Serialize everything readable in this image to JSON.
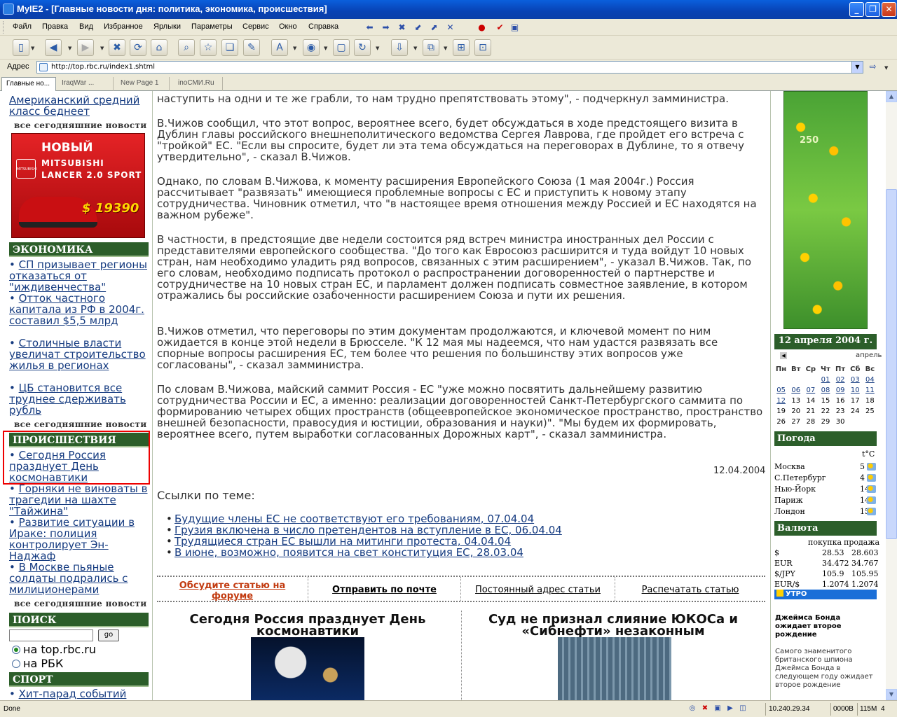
{
  "window": {
    "title": "MyIE2 - [Главные новости дня: политика, экономика, происшествия]",
    "buttons": [
      "_",
      "❐",
      "✕"
    ]
  },
  "menu": {
    "items": [
      "Файл",
      "Правка",
      "Вид",
      "Избранное",
      "Ярлыки",
      "Параметры",
      "Сервис",
      "Окно",
      "Справка"
    ]
  },
  "address": {
    "label": "Адрес",
    "url": "http://top.rbc.ru/index1.shtml"
  },
  "tabs": [
    "Главные но...",
    "IraqWar ...",
    "New Page 1",
    "inoСМИ.Ru"
  ],
  "left": {
    "top_news_tail": "Американский средний класс беднеет",
    "all_news": "все сегодняшние новости",
    "ad": {
      "line1": "НОВЫЙ",
      "line2": "MITSUBISHI",
      "line3": "LANCER 2.0 SPORT",
      "price": "$ 19390",
      "logo": "MITSUBISHI"
    },
    "economy": {
      "title": "ЭКОНОМИКА",
      "items": [
        "СП призывает регионы отказаться от \"иждивенчества\"",
        "Отток частного капитала из РФ в 2004г. составил $5,5 млрд",
        "Столичные власти увеличат строительство жилья в регионах",
        "ЦБ становится все труднее сдерживать рубль"
      ]
    },
    "incidents": {
      "title": "ПРОИСШЕСТВИЯ",
      "items": [
        "Сегодня Россия празднует День космонавтики",
        "Горняки не виноваты в трагедии на шахте \"Тайжина\"",
        "Развитие ситуации в Ираке: полиция контролирует Эн-Наджаф",
        "В Москве пьяные солдаты подрались с милиционерами"
      ]
    },
    "search": {
      "title": "ПОИСК",
      "go": "go",
      "options": [
        "на top.rbc.ru",
        "на РБК"
      ]
    },
    "sport": {
      "title": "СПОРТ",
      "items": [
        "Хит-парад событий"
      ]
    }
  },
  "article": {
    "paragraphs": [
      "наступить на одни и те же грабли, то нам трудно препятствовать этому\", - подчеркнул замминистра.",
      "В.Чижов сообщил, что этот вопрос, вероятнее всего, будет обсуждаться в ходе предстоящего визита в Дублин главы российского внешнеполитического ведомства Сергея Лаврова, где пройдет его встреча с \"тройкой\" ЕС. \"Если вы спросите, будет ли эта тема обсуждаться на переговорах в Дублине, то я отвечу утвердительно\", - сказал В.Чижов.",
      "Однако, по словам В.Чижова, к моменту расширения Европейского Союза (1 мая 2004г.) Россия рассчитывает \"развязать\" имеющиеся проблемные вопросы с ЕС и приступить к новому этапу сотрудничества. Чиновник отметил, что \"в настоящее время отношения между Россией и ЕС находятся на важном рубеже\".",
      "В частности, в предстоящие две недели состоится ряд встреч министра иностранных дел России с представителями европейского сообщества. \"До того как Евросоюз расширится и туда войдут 10 новых стран, нам необходимо уладить ряд вопросов, связанных с этим расширением\", - указал В.Чижов. Так, по его словам, необходимо подписать протокол о распространении договоренностей о партнерстве и сотрудничестве на 10 новых стран ЕС, и парламент должен подписать совместное заявление, в котором отражались бы российские озабоченности расширением Союза и пути их решения.",
      "В.Чижов отметил, что переговоры по этим документам продолжаются, и ключевой момент по ним ожидается в конце этой недели в Брюсселе. \"К 12 мая мы надеемся, что нам удастся развязать все спорные вопросы расширения ЕС, тем более что решения по большинству этих вопросов уже согласованы\", - сказал замминистра.",
      "По словам В.Чижова, майский саммит Россия - ЕС \"уже можно посвятить дальнейшему развитию сотрудничества России и ЕС, а именно: реализации договоренностей Санкт-Петербургского саммита по формированию четырех общих пространств (общеевропейское экономическое пространство, пространство внешней безопасности, правосудия и юстиции, образования и науки)\". \"Мы будем их формировать, вероятнее всего, путем выработки согласованных Дорожных карт\", - сказал замминистра."
    ],
    "date": "12.04.2004",
    "related_title": "Ссылки по теме:",
    "related": [
      "Будущие члены ЕС не соответствуют его требованиям, 07.04.04",
      "Грузия включена в число претендентов на вступление в ЕС, 06.04.04",
      "Трудящиеся стран ЕС вышли на митинги протеста, 04.04.04",
      "В июне, возможно, появится на свет конституция ЕС, 28.03.04"
    ],
    "actions": [
      "Обсудите статью на форуме",
      "Отправить по почте",
      "Постоянный адрес статьи",
      "Распечатать статью"
    ],
    "teasers": [
      "Сегодня Россия празднует День космонавтики",
      "Суд не признал слияние ЮКОСа и «Сибнефти» незаконным"
    ]
  },
  "right": {
    "banner_number": "250",
    "calendar": {
      "date": "12 апреля 2004 г.",
      "month": "апрель",
      "weekdays": [
        "Пн",
        "Вт",
        "Ср",
        "Чт",
        "Пт",
        "Сб",
        "Вс"
      ],
      "weeks": [
        [
          "",
          "",
          "",
          "01",
          "02",
          "03",
          "04"
        ],
        [
          "05",
          "06",
          "07",
          "08",
          "09",
          "10",
          "11"
        ],
        [
          "12",
          "13",
          "14",
          "15",
          "16",
          "17",
          "18"
        ],
        [
          "19",
          "20",
          "21",
          "22",
          "23",
          "24",
          "25"
        ],
        [
          "26",
          "27",
          "28",
          "29",
          "30",
          "",
          ""
        ]
      ]
    },
    "weather": {
      "title": "Погода",
      "unit": "t°C",
      "rows": [
        {
          "city": "Москва",
          "temp": "5"
        },
        {
          "city": "С.Петербург",
          "temp": "4"
        },
        {
          "city": "Нью-Йорк",
          "temp": "14"
        },
        {
          "city": "Париж",
          "temp": "14"
        },
        {
          "city": "Лондон",
          "temp": "15"
        }
      ]
    },
    "currency": {
      "title": "Валюта",
      "buy": "покупка",
      "sell": "продажа",
      "rows": [
        {
          "name": "$",
          "buy": "28.53",
          "sell": "28.603"
        },
        {
          "name": "EUR",
          "buy": "34.472",
          "sell": "34.767"
        },
        {
          "name": "$/JPY",
          "buy": "105.9",
          "sell": "105.95"
        },
        {
          "name": "EUR/$",
          "buy": "1.2074",
          "sell": "1.2074"
        }
      ]
    },
    "utro": "УТРО",
    "bond_title": "Джеймса Бонда ожидает второе рождение",
    "bond_text": "Самого знаменитого британского шпиона Джеймса Бонда в следующем году ожидает второе рождение"
  },
  "status": {
    "text": "Done",
    "ip": "10.240.29.34",
    "mem1": "0000B",
    "mem2": "115M",
    "num": "4"
  }
}
